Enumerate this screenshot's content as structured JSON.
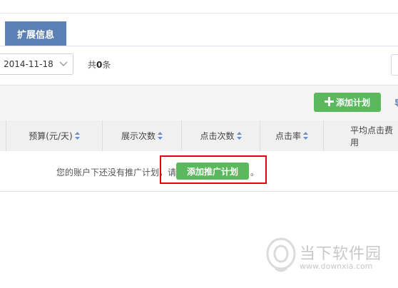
{
  "tabs": {
    "active": "扩展信息"
  },
  "filters": {
    "date_value": "2014-11-18",
    "total_prefix": "共",
    "total_count": "0",
    "total_suffix": "条"
  },
  "toolbar": {
    "add_plan_label": "添加计划",
    "edge_glyph": "导"
  },
  "table": {
    "columns": [
      "预算(元/天)",
      "展示次数",
      "点击次数",
      "点击率",
      "平均点击费用"
    ]
  },
  "empty_state": {
    "message": "您的账户下还没有推广计划，请",
    "button_label": "添加推广计划",
    "tail": "。"
  },
  "watermark": {
    "title": "当下软件园",
    "url": "www.downxia.com"
  },
  "colors": {
    "tab_blue": "#5b80b6",
    "button_green": "#5cb85c",
    "highlight_red": "#e60012"
  }
}
